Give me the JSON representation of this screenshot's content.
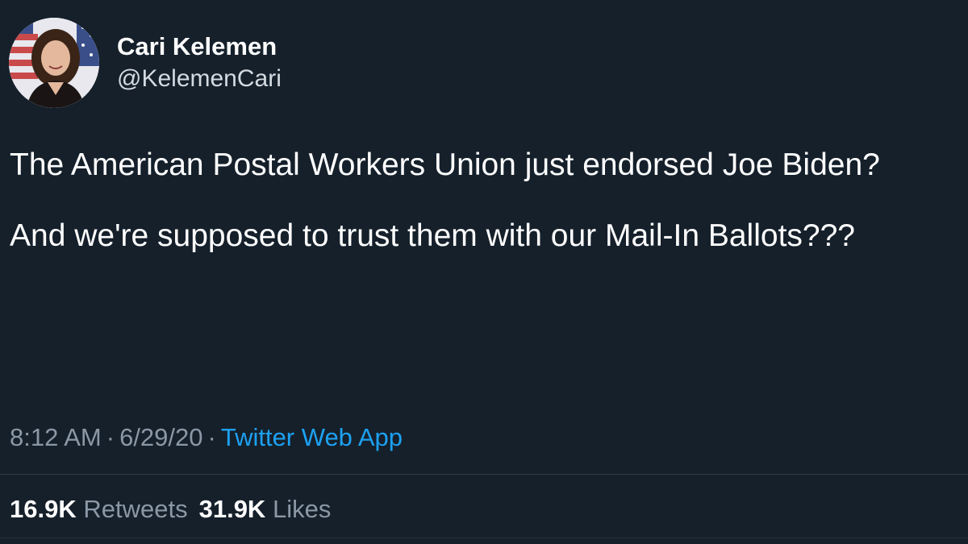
{
  "author": {
    "name": "Cari Kelemen",
    "handle": "@KelemenCari",
    "avatar": "profile-photo"
  },
  "tweet": {
    "paragraphs": [
      "The American Postal Workers Union just endorsed Joe Biden?",
      "And we're supposed to trust them with our Mail-In Ballots???"
    ]
  },
  "meta": {
    "time": "8:12 AM",
    "separator": "·",
    "date": "6/29/20",
    "source": "Twitter Web App"
  },
  "stats": {
    "retweets_count": "16.9K",
    "retweets_label": "Retweets",
    "likes_count": "31.9K",
    "likes_label": "Likes"
  },
  "colors": {
    "background": "#15202b",
    "text": "#ffffff",
    "muted": "#8b98a5",
    "link": "#1da1f2"
  }
}
